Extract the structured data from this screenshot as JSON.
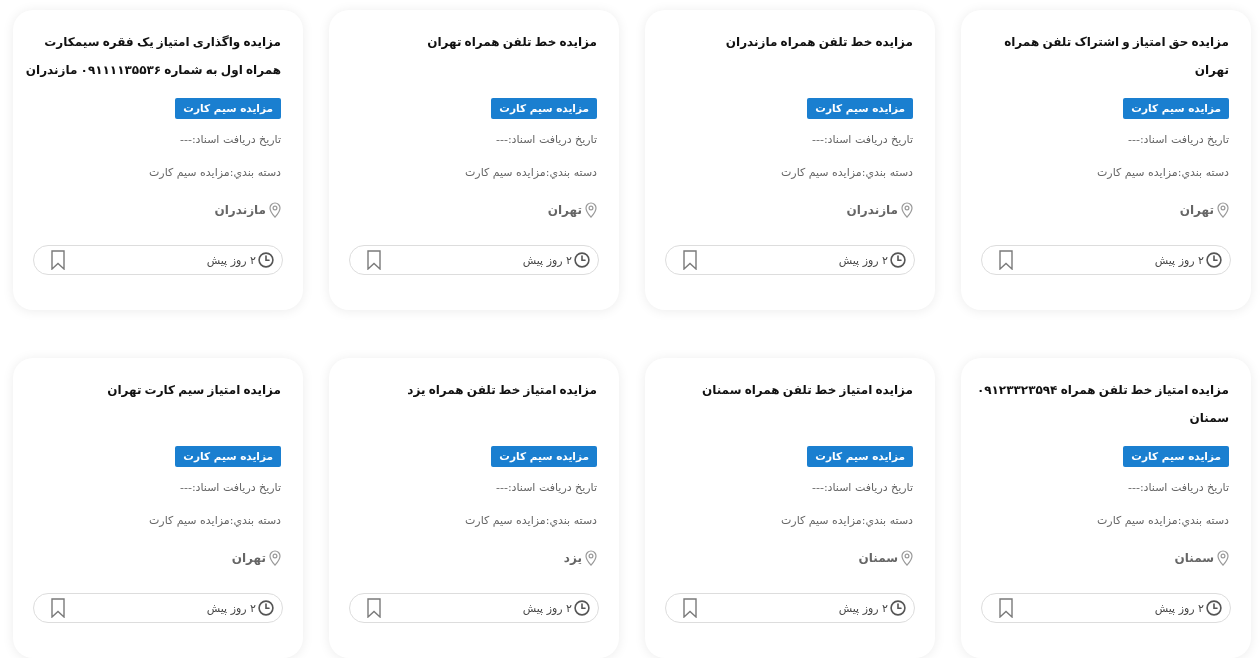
{
  "cards": [
    {
      "title": "مزایده حق امتیاز و اشتراک تلفن همراه تهران",
      "badge": "مزایده سیم کارت",
      "document_date": "تاریخ دریافت اسناد:---",
      "category": "دسته بندي:مزایده سیم کارت",
      "location": "تهران",
      "posted": "۲ روز پیش",
      "bookmarked": false
    },
    {
      "title": "مزایده خط تلفن همراه مازندران",
      "badge": "مزایده سیم کارت",
      "document_date": "تاریخ دریافت اسناد:---",
      "category": "دسته بندي:مزایده سیم کارت",
      "location": "مازندران",
      "posted": "۲ روز پیش",
      "bookmarked": false
    },
    {
      "title": "مزایده خط تلفن همراه تهران",
      "badge": "مزایده سیم کارت",
      "document_date": "تاریخ دریافت اسناد:---",
      "category": "دسته بندي:مزایده سیم کارت",
      "location": "تهران",
      "posted": "۲ روز پیش",
      "bookmarked": false
    },
    {
      "title": "مزایده واگذاری امتیاز یک فقره سیمکارت همراه اول به شماره ۰۹۱۱۱۱۳۵۵۳۶ مازندران",
      "badge": "مزایده سیم کارت",
      "document_date": "تاریخ دریافت اسناد:---",
      "category": "دسته بندي:مزایده سیم کارت",
      "location": "مازندران",
      "posted": "۲ روز پیش",
      "bookmarked": false
    },
    {
      "title": "مزایده امتیاز خط تلفن همراه ۰۹۱۲۳۳۲۳۵۹۴ سمنان",
      "badge": "مزایده سیم کارت",
      "document_date": "تاریخ دریافت اسناد:---",
      "category": "دسته بندي:مزایده سیم کارت",
      "location": "سمنان",
      "posted": "۲ روز پیش",
      "bookmarked": false
    },
    {
      "title": "مزایده امتیاز خط تلفن همراه سمنان",
      "badge": "مزایده سیم کارت",
      "document_date": "تاریخ دریافت اسناد:---",
      "category": "دسته بندي:مزایده سیم کارت",
      "location": "سمنان",
      "posted": "۲ روز پیش",
      "bookmarked": false
    },
    {
      "title": "مزایده امتیاز خط تلفن همراه یزد",
      "badge": "مزایده سیم کارت",
      "document_date": "تاریخ دریافت اسناد:---",
      "category": "دسته بندي:مزایده سیم کارت",
      "location": "یزد",
      "posted": "۲ روز پیش",
      "bookmarked": false
    },
    {
      "title": "مزایده امتیاز سیم کارت تهران",
      "badge": "مزایده سیم کارت",
      "document_date": "تاریخ دریافت اسناد:---",
      "category": "دسته بندي:مزایده سیم کارت",
      "location": "تهران",
      "posted": "۲ روز پیش",
      "bookmarked": false
    }
  ]
}
